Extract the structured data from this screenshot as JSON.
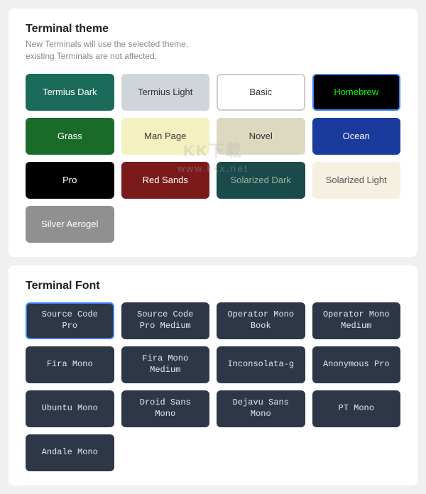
{
  "terminal_theme": {
    "title": "Terminal theme",
    "subtitle": "New Terminals will use the selected theme,\nexisting Terminals are not affected.",
    "themes": [
      {
        "id": "termius-dark",
        "label": "Termius Dark",
        "bg": "#1a6b5a",
        "color": "#ffffff",
        "selected": false
      },
      {
        "id": "termius-light",
        "label": "Termius Light",
        "bg": "#d0d4db",
        "color": "#333333",
        "selected": false
      },
      {
        "id": "basic",
        "label": "Basic",
        "bg": "#ffffff",
        "color": "#333333",
        "selected": false,
        "border": "#ccc"
      },
      {
        "id": "homebrew",
        "label": "Homebrew",
        "bg": "#000000",
        "color": "#00ff00",
        "selected": true
      },
      {
        "id": "grass",
        "label": "Grass",
        "bg": "#1a6b2a",
        "color": "#ffffff",
        "selected": false
      },
      {
        "id": "man-page",
        "label": "Man Page",
        "bg": "#f5f0c0",
        "color": "#333333",
        "selected": false
      },
      {
        "id": "novel",
        "label": "Novel",
        "bg": "#ddd8c0",
        "color": "#333333",
        "selected": false
      },
      {
        "id": "ocean",
        "label": "Ocean",
        "bg": "#1a3a9e",
        "color": "#ffffff",
        "selected": false
      },
      {
        "id": "pro",
        "label": "Pro",
        "bg": "#000000",
        "color": "#ffffff",
        "selected": false
      },
      {
        "id": "red-sands",
        "label": "Red Sands",
        "bg": "#7a1a1a",
        "color": "#ffffff",
        "selected": false
      },
      {
        "id": "solarized-dark",
        "label": "Solarized Dark",
        "bg": "#1a4a4a",
        "color": "#a0b0a0",
        "selected": false
      },
      {
        "id": "solarized-light",
        "label": "Solarized Light",
        "bg": "#f5f0e0",
        "color": "#555555",
        "selected": false
      },
      {
        "id": "silver-aerogel",
        "label": "Silver Aerogel",
        "bg": "#909090",
        "color": "#ffffff",
        "selected": false
      }
    ]
  },
  "terminal_font": {
    "title": "Terminal Font",
    "fonts": [
      {
        "id": "source-code-pro",
        "label": "Source Code Pro",
        "selected": true
      },
      {
        "id": "source-code-pro-medium",
        "label": "Source Code Pro Medium",
        "selected": false
      },
      {
        "id": "operator-mono-book",
        "label": "Operator Mono Book",
        "selected": false
      },
      {
        "id": "operator-mono-medium",
        "label": "Operator Mono Medium",
        "selected": false
      },
      {
        "id": "fira-mono",
        "label": "Fira Mono",
        "selected": false
      },
      {
        "id": "fira-mono-medium",
        "label": "Fira Mono Medium",
        "selected": false
      },
      {
        "id": "inconsolata-g",
        "label": "Inconsolata-g",
        "selected": false
      },
      {
        "id": "anonymous-pro",
        "label": "Anonymous Pro",
        "selected": false
      },
      {
        "id": "ubuntu-mono",
        "label": "Ubuntu Mono",
        "selected": false
      },
      {
        "id": "droid-sans-mono",
        "label": "Droid Sans Mono",
        "selected": false
      },
      {
        "id": "dejavu-sans-mono",
        "label": "Dejavu Sans Mono",
        "selected": false
      },
      {
        "id": "pt-mono",
        "label": "PT Mono",
        "selected": false
      },
      {
        "id": "andale-mono",
        "label": "Andale Mono",
        "selected": false
      }
    ]
  },
  "watermark": {
    "line1": "KK下载",
    "line2": "www.kkx.net"
  }
}
